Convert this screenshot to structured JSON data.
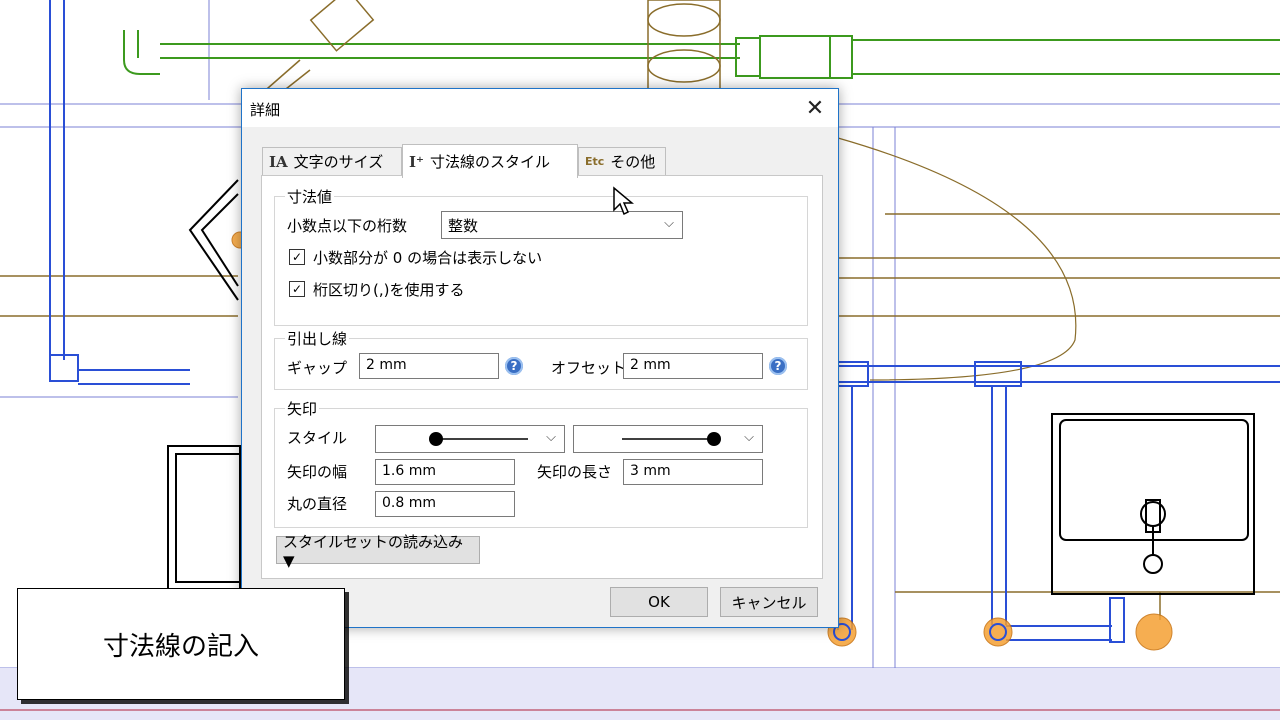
{
  "dialog": {
    "title": "詳細",
    "close_glyph": "✕",
    "tabs": [
      {
        "icon": "IA",
        "label": "文字のサイズ"
      },
      {
        "icon": "I⁺",
        "label": "寸法線のスタイル"
      },
      {
        "icon": "Etc",
        "label": "その他"
      }
    ],
    "dimension_value": {
      "group_label": "寸法値",
      "decimal_label": "小数点以下の桁数",
      "decimal_value": "整数",
      "hide_zero_label": "小数部分が 0 の場合は表示しない",
      "hide_zero_checked": true,
      "separator_label": "桁区切り(,)を使用する",
      "separator_checked": true
    },
    "leader": {
      "group_label": "引出し線",
      "gap_label": "ギャップ",
      "gap_value": "2 mm",
      "offset_label": "オフセット",
      "offset_value": "2 mm"
    },
    "arrow": {
      "group_label": "矢印",
      "style_label": "スタイル",
      "width_label": "矢印の幅",
      "width_value": "1.6 mm",
      "length_label": "矢印の長さ",
      "length_value": "3 mm",
      "dot_label": "丸の直径",
      "dot_value": "0.8 mm"
    },
    "style_set_button": "スタイルセットの読み込み ▼",
    "ok_button": "OK",
    "cancel_button": "キャンセル",
    "help_glyph": "?",
    "check_glyph": "✓",
    "dropdown_glyph": "⌵"
  },
  "caption": "寸法線の記入",
  "colors": {
    "pipe_blue": "#2a4fd6",
    "pipe_green": "#3c9a1e",
    "fixture_gold": "#8a6d2b",
    "fitting_orange": "#f5a033",
    "titlebar_border": "#1f73c8"
  }
}
